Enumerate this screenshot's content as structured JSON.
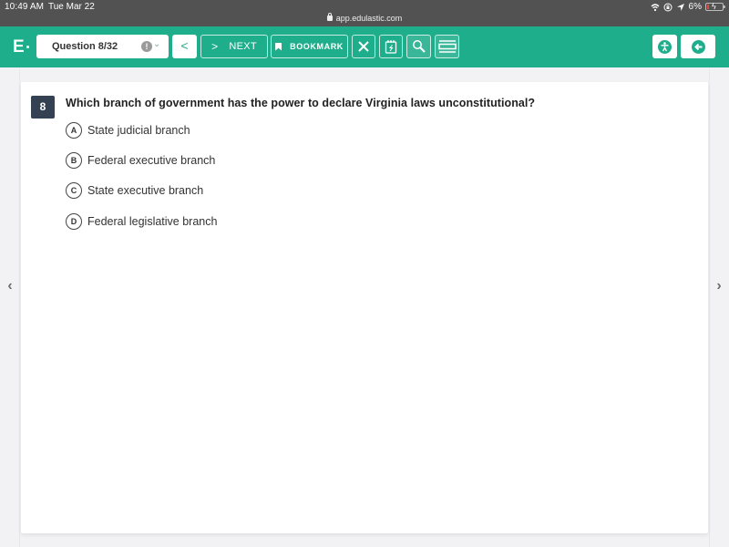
{
  "status_bar": {
    "time": "10:49 AM",
    "date": "Tue Mar 22",
    "url": "app.edulastic.com",
    "battery": "6%",
    "battery_level_percent": 6,
    "icons": [
      "wifi-icon",
      "orientation-lock-icon",
      "location-icon",
      "battery-charging-icon"
    ]
  },
  "toolbar": {
    "logo": "E",
    "question_select": "Question 8/32",
    "prev_label": "<",
    "next_label": "NEXT",
    "bookmark_label": "BOOKMARK",
    "brand_color": "#1fae8b"
  },
  "question": {
    "number": "8",
    "text": "Which branch of government has the power to declare Virginia laws unconstitutional?",
    "options": [
      {
        "letter": "A",
        "text": "State judicial branch"
      },
      {
        "letter": "B",
        "text": "Federal executive branch"
      },
      {
        "letter": "C",
        "text": "State executive branch"
      },
      {
        "letter": "D",
        "text": "Federal legislative branch"
      }
    ]
  },
  "nav": {
    "prev_arrow": "‹",
    "next_arrow": "›"
  }
}
